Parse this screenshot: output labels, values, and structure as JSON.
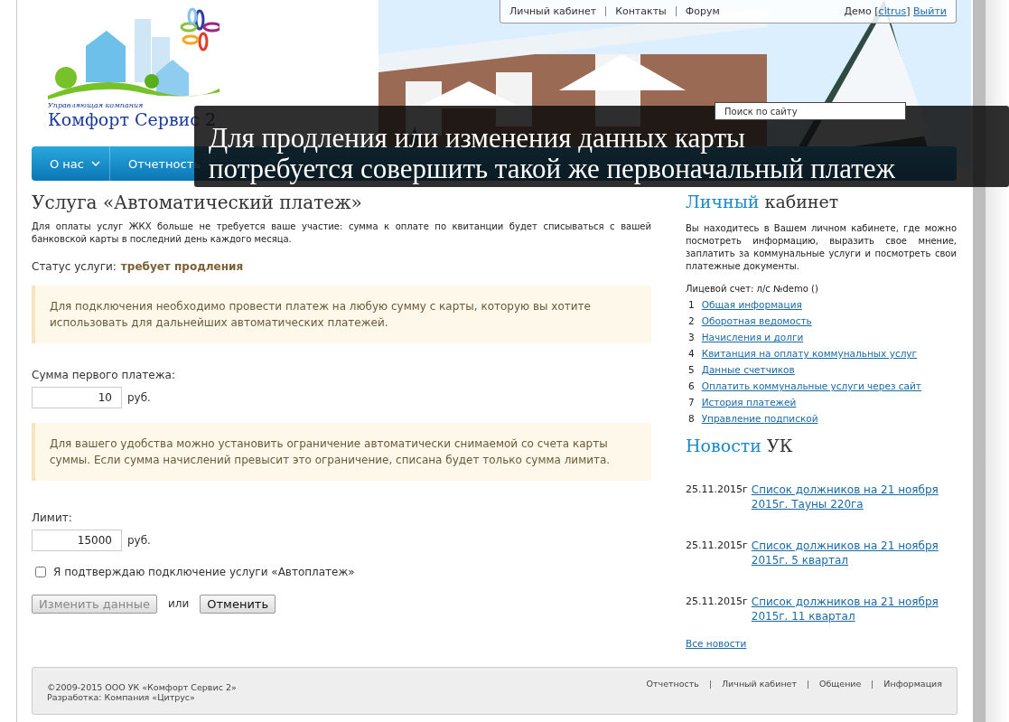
{
  "top_links": [
    "Личный кабинет",
    "Контакты",
    "Форум"
  ],
  "user": {
    "prefix": "Демо",
    "bracket_open": "[",
    "login": "citrus",
    "bracket_close": "]",
    "logout": "Выйти"
  },
  "logo": {
    "tagline": "Управляющая компания",
    "name": "Комфорт Сервис 2"
  },
  "search": {
    "placeholder": "Поиск по сайту"
  },
  "nav": [
    {
      "label": "О нас",
      "dropdown": true
    },
    {
      "label": "Отчетность",
      "dropdown": false
    }
  ],
  "caption": [
    "Для продления или изменения данных карты",
    "потребуется совершить такой же первоначальный платеж"
  ],
  "main": {
    "title": "Услуга «Автоматический платеж»",
    "intro": "Для оплаты услуг ЖКХ больше не требуется ваше участие: сумма к оплате по квитанции будет списываться с вашей банковской карты в последний день каждого месяца.",
    "status_label": "Статус услуги:",
    "status_value": "требует продления",
    "notice_1": "Для подключения необходимо провести платеж на любую сумму с карты, которую вы хотите использовать для дальнейших автоматических платежей.",
    "first_payment": {
      "label": "Сумма первого платежа:",
      "value": "10",
      "unit": "руб."
    },
    "notice_2": "Для вашего удобства можно установить ограничение автоматически снимаемой со счета карты суммы. Если сумма начислений превысит это ограничение, списана будет только сумма лимита.",
    "limit": {
      "label": "Лимит:",
      "value": "15000",
      "unit": "руб."
    },
    "confirm": {
      "label": "Я подтверждаю подключение услуги «Автоплатеж»",
      "checked": false
    },
    "submit": {
      "label": "Изменить данные",
      "disabled": true
    },
    "or": "или",
    "cancel": {
      "label": "Отменить",
      "disabled": false
    }
  },
  "sidebar": {
    "title_accent": "Личный",
    "title_rest": "кабинет",
    "about": "Вы находитесь в Вашем личном кабинете, где можно посмотреть информацию, выразить свое мнение, заплатить за коммунальные услуги и посмотреть свои платежные документы.",
    "account": "Лицевой счет: л/с №demo ()",
    "menu": [
      {
        "number": "1",
        "label": "Общая информация"
      },
      {
        "number": "2",
        "label": "Оборотная ведомость"
      },
      {
        "number": "3",
        "label": "Начисления и долги"
      },
      {
        "number": "4",
        "label": "Квитанция на оплату коммунальных услуг"
      },
      {
        "number": "5",
        "label": "Данные счетчиков"
      },
      {
        "number": "6",
        "label": "Оплатить коммунальные услуги через сайт"
      },
      {
        "number": "7",
        "label": "История платежей"
      },
      {
        "number": "8",
        "label": "Управление подпиской"
      }
    ],
    "news_title_accent": "Новости",
    "news_title_rest": "УК",
    "news": [
      {
        "date": "25.11.2015г",
        "title": "Список должников на 21 ноября 2015г. Тауны 220га"
      },
      {
        "date": "25.11.2015г",
        "title": "Список должников на 21 ноября 2015г. 5 квартал"
      },
      {
        "date": "25.11.2015г",
        "title": "Список должников на 21 ноября 2015г. 11 квартал"
      }
    ],
    "all_news": "Все новости"
  },
  "footer": {
    "copyright": "©2009-2015 ООО УК «Комфорт Сервис 2»",
    "developer": "Разработка: Компания «Цитрус»",
    "links": [
      "Отчетность",
      "Личный кабинет",
      "Общение",
      "Информация"
    ]
  }
}
